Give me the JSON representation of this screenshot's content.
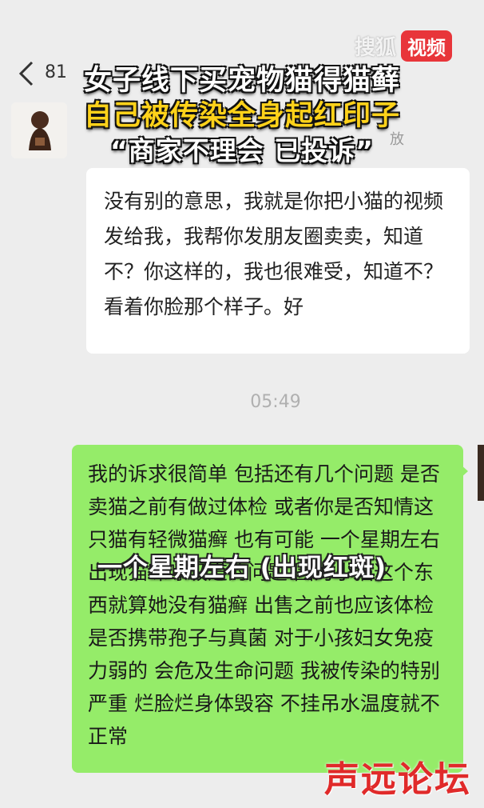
{
  "header": {
    "chat_count": "81",
    "brand_text": "搜狐",
    "brand_badge": "视频"
  },
  "overlay": {
    "title_line1": "女子线下买宠物猫得猫藓",
    "title_line2": "自己被传染全身起红印子",
    "title_line3": "“商家不理会 已投诉”"
  },
  "partial_text": "放",
  "messages": {
    "incoming": "没有别的意思，我就是你把小猫的视频发给我，我帮你发朋友圈卖卖，知道不？你这样的，我也很难受，知道不？看着你脸那个样子。好",
    "timestamp": "05:49",
    "outgoing": "我的诉求很简单 包括还有几个问题 是否卖猫之前有做过体检 或者你是否知情这只猫有轻微猫癣 也有可能 一个星期左右 出现猫咪呼吸道的问题 因为小猫这个东西就算她没有猫癣 出售之前也应该体检是否携带孢子与真菌 对于小孩妇女免疫力弱的 会危及生命问题 我被传染的特别严重 烂脸烂身体毁容 不挂吊水温度就不正常"
  },
  "subtitle": "一个星期左右 (出现红斑)",
  "watermark": "声远论坛",
  "colors": {
    "background": "#ededed",
    "incoming_bubble": "#ffffff",
    "outgoing_bubble": "#95ec69",
    "title_highlight": "#ffd21a",
    "brand_red": "#e8353a"
  }
}
